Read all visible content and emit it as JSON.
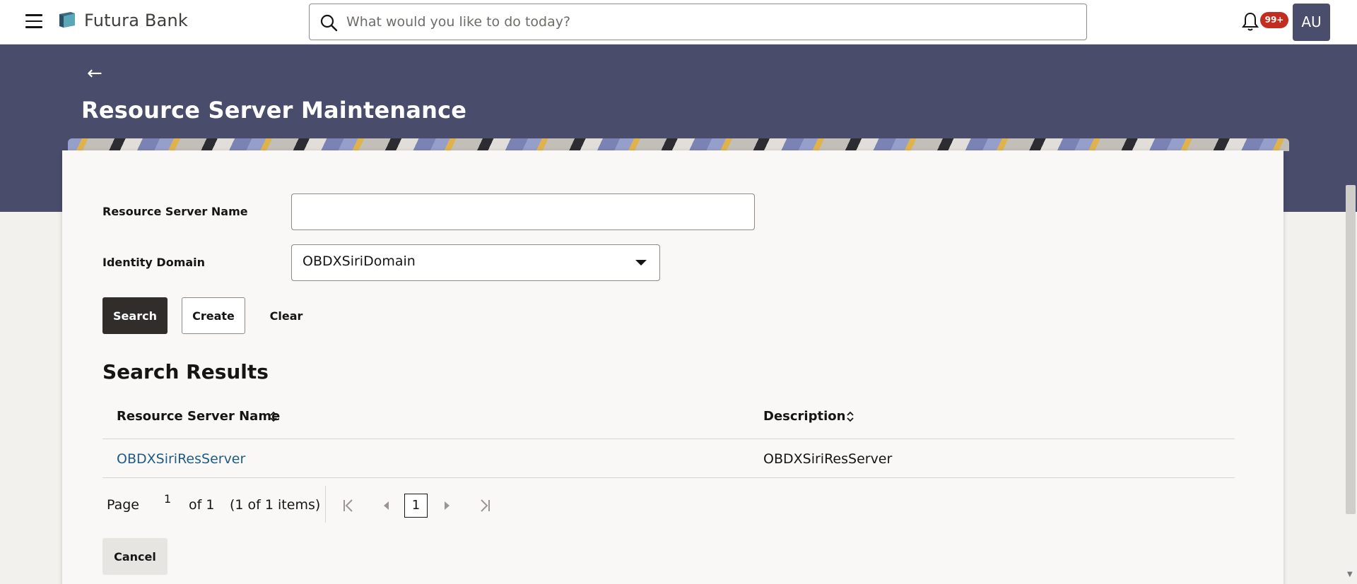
{
  "header": {
    "brand": "Futura Bank",
    "search_placeholder": "What would you like to do today?",
    "notifications_badge": "99+",
    "avatar_initials": "AU"
  },
  "page": {
    "title": "Resource Server Maintenance"
  },
  "form": {
    "resource_server_name_label": "Resource Server Name",
    "resource_server_name_value": "",
    "identity_domain_label": "Identity Domain",
    "identity_domain_value": "OBDXSiriDomain"
  },
  "actions": {
    "search": "Search",
    "create": "Create",
    "clear": "Clear",
    "cancel": "Cancel"
  },
  "results": {
    "title": "Search Results",
    "columns": [
      "Resource Server Name",
      "Description"
    ],
    "rows": [
      {
        "name": "OBDXSiriResServer",
        "description": "OBDXSiriResServer"
      }
    ]
  },
  "pagination": {
    "page_label": "Page",
    "current_page": "1",
    "of_label": "of 1",
    "items_label": "(1 of 1 items)",
    "page_box": "1"
  },
  "colors": {
    "banner": "#494c6a",
    "link": "#1f5c85",
    "primary_button": "#312d2a",
    "badge": "#c22d1f"
  }
}
